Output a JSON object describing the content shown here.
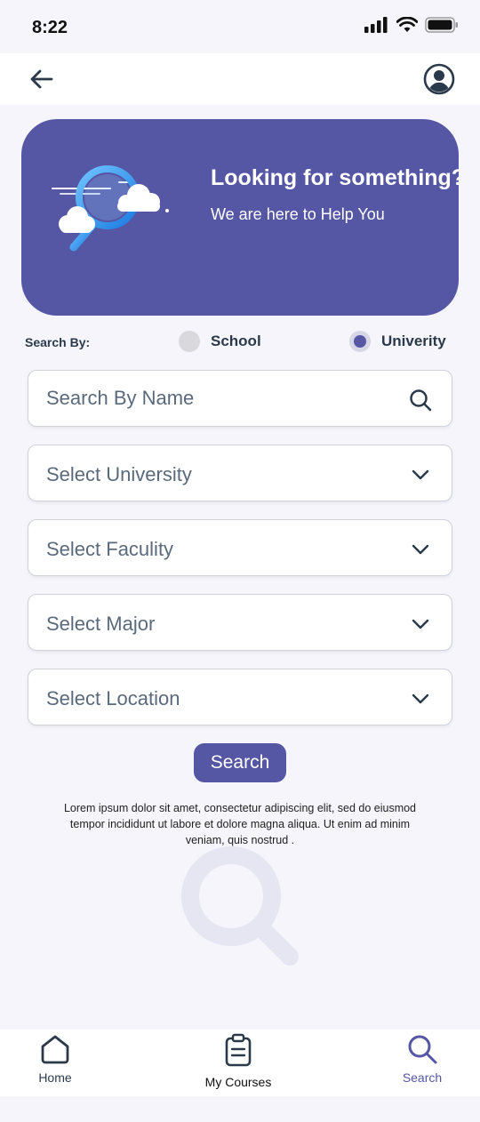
{
  "status_bar": {
    "time": "8:22",
    "icons": [
      "signal-icon",
      "wifi-icon",
      "battery-icon"
    ]
  },
  "app_bar": {
    "back_icon": "arrow-left-icon",
    "profile_icon": "user-circle-icon"
  },
  "hero": {
    "title": "Looking for something?",
    "subtitle": "We are here to Help You",
    "illustration": "magnifier-clouds-illustration",
    "background_color": "#5556a4"
  },
  "search_by": {
    "label": "Search By:",
    "options": [
      {
        "label": "School",
        "selected": false
      },
      {
        "label": "Univerity",
        "selected": true
      }
    ]
  },
  "form": {
    "name_placeholder": "Search By Name",
    "name_value": "",
    "selects": [
      {
        "placeholder": "Select University"
      },
      {
        "placeholder": "Select Faculity"
      },
      {
        "placeholder": "Select Major"
      },
      {
        "placeholder": "Select Location"
      }
    ],
    "search_button": "Search"
  },
  "description": "Lorem ipsum dolor sit amet, consectetur adipiscing elit, sed do eiusmod tempor incididunt ut labore et dolore magna aliqua. Ut enim ad minim veniam, quis nostrud .",
  "bottom_nav": {
    "items": [
      {
        "label": "Home",
        "icon": "home-icon",
        "active": false
      },
      {
        "label": "My Courses",
        "icon": "clipboard-icon",
        "active": false
      },
      {
        "label": "Search",
        "icon": "search-icon",
        "active": true
      }
    ]
  },
  "colors": {
    "accent": "#5556a4",
    "background": "#f5f5fb",
    "text": "#2b3a4a"
  }
}
